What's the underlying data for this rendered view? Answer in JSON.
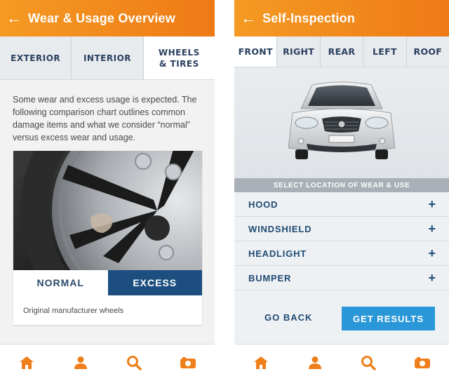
{
  "left_screen": {
    "header": {
      "back_icon": "arrow-left-icon",
      "title": "Wear & Usage Overview"
    },
    "tabs": [
      {
        "label": "EXTERIOR",
        "active": false
      },
      {
        "label": "INTERIOR",
        "active": false
      },
      {
        "label": "WHEELS\n& TIRES",
        "active": true
      }
    ],
    "intro_text": "Some wear and excess usage is expected. The following comparison chart outlines common damage items and what we consider “normal” versus excess wear and usage.",
    "comparison": {
      "normal_label": "NORMAL",
      "excess_label": "EXCESS",
      "selected": "EXCESS"
    },
    "caption": "Original manufacturer wheels"
  },
  "right_screen": {
    "header": {
      "back_icon": "arrow-left-icon",
      "title": "Self-Inspection"
    },
    "tabs": [
      {
        "label": "FRONT",
        "active": true
      },
      {
        "label": "RIGHT",
        "active": false
      },
      {
        "label": "REAR",
        "active": false
      },
      {
        "label": "LEFT",
        "active": false
      },
      {
        "label": "ROOF",
        "active": false
      }
    ],
    "select_bar": "SELECT LOCATION OF WEAR & USE",
    "locations": [
      {
        "label": "HOOD",
        "icon": "plus-icon"
      },
      {
        "label": "WINDSHIELD",
        "icon": "plus-icon"
      },
      {
        "label": "HEADLIGHT",
        "icon": "plus-icon"
      },
      {
        "label": "BUMPER",
        "icon": "plus-icon"
      }
    ],
    "actions": {
      "back_label": "GO BACK",
      "results_label": "GET RESULTS"
    }
  },
  "bottom_nav": [
    "home-icon",
    "user-icon",
    "search-icon",
    "camera-icon"
  ],
  "colors": {
    "header_orange": "#f28a1c",
    "navy": "#1c4f80",
    "accent_blue": "#2a98d8",
    "nav_orange": "#ef7f1a"
  }
}
